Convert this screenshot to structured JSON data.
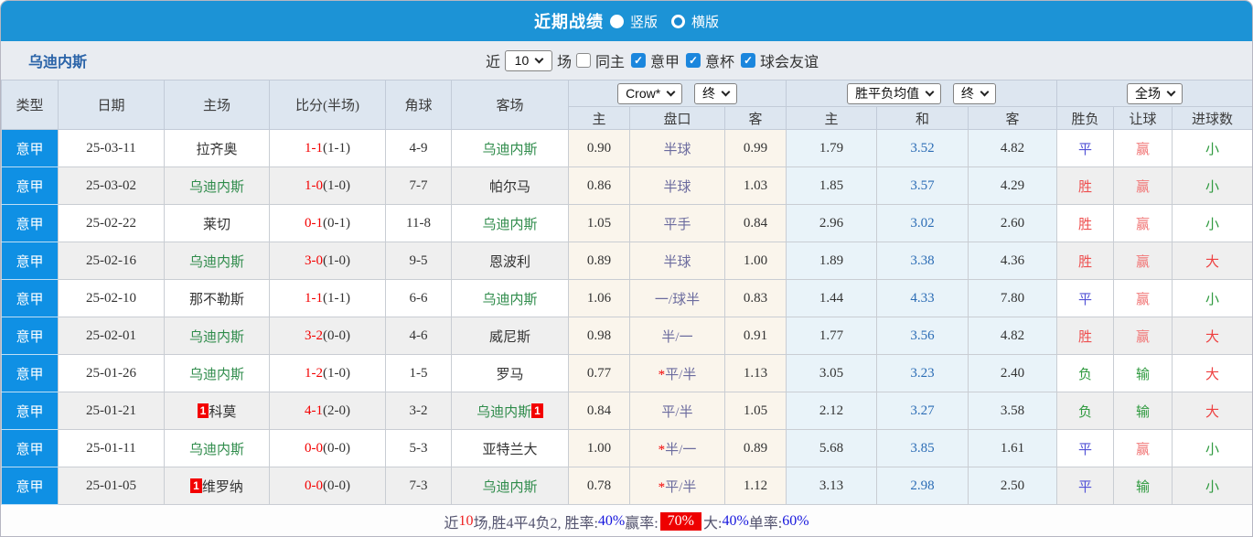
{
  "titlebar": {
    "title": "近期战绩",
    "radios": [
      {
        "label": "竖版",
        "checked": false
      },
      {
        "label": "横版",
        "checked": true
      }
    ]
  },
  "filterbar": {
    "team": "乌迪内斯",
    "recent_label": "近",
    "recent_value": "10",
    "matches_label": "场",
    "checkboxes": [
      {
        "label": "同主",
        "checked": false
      },
      {
        "label": "意甲",
        "checked": true
      },
      {
        "label": "意杯",
        "checked": true
      },
      {
        "label": "球会友谊",
        "checked": true
      }
    ]
  },
  "table": {
    "controls": {
      "bookmaker": "Crow*",
      "handicap_time": "终",
      "odds_source": "胜平负均值",
      "odds_time": "终",
      "scope": "全场"
    },
    "headers": {
      "type": "类型",
      "date": "日期",
      "home": "主场",
      "score": "比分(半场)",
      "corner": "角球",
      "away": "客场",
      "ah_home": "主",
      "ah_line": "盘口",
      "ah_away": "客",
      "eu_home": "主",
      "eu_draw": "和",
      "eu_away": "客",
      "result": "胜负",
      "handicap_result": "让球",
      "goals": "进球数"
    },
    "red_card_badge": "1",
    "rows": [
      {
        "league": "意甲",
        "date": "25-03-11",
        "home": "拉齐奥",
        "home_red": false,
        "score": "1-1",
        "half": "(1-1)",
        "corner": "4-9",
        "away": "乌迪内斯",
        "away_red": false,
        "ah_home": "0.90",
        "ah_star": false,
        "ah_line": "半球",
        "ah_away": "0.99",
        "eu_home": "1.79",
        "eu_draw": "3.52",
        "eu_away": "4.82",
        "result": "平",
        "handicap": "赢",
        "goals": "小"
      },
      {
        "league": "意甲",
        "date": "25-03-02",
        "home": "乌迪内斯",
        "home_red": false,
        "score": "1-0",
        "half": "(1-0)",
        "corner": "7-7",
        "away": "帕尔马",
        "away_red": false,
        "ah_home": "0.86",
        "ah_star": false,
        "ah_line": "半球",
        "ah_away": "1.03",
        "eu_home": "1.85",
        "eu_draw": "3.57",
        "eu_away": "4.29",
        "result": "胜",
        "handicap": "赢",
        "goals": "小"
      },
      {
        "league": "意甲",
        "date": "25-02-22",
        "home": "莱切",
        "home_red": false,
        "score": "0-1",
        "half": "(0-1)",
        "corner": "11-8",
        "away": "乌迪内斯",
        "away_red": false,
        "ah_home": "1.05",
        "ah_star": false,
        "ah_line": "平手",
        "ah_away": "0.84",
        "eu_home": "2.96",
        "eu_draw": "3.02",
        "eu_away": "2.60",
        "result": "胜",
        "handicap": "赢",
        "goals": "小"
      },
      {
        "league": "意甲",
        "date": "25-02-16",
        "home": "乌迪内斯",
        "home_red": false,
        "score": "3-0",
        "half": "(1-0)",
        "corner": "9-5",
        "away": "恩波利",
        "away_red": false,
        "ah_home": "0.89",
        "ah_star": false,
        "ah_line": "半球",
        "ah_away": "1.00",
        "eu_home": "1.89",
        "eu_draw": "3.38",
        "eu_away": "4.36",
        "result": "胜",
        "handicap": "赢",
        "goals": "大"
      },
      {
        "league": "意甲",
        "date": "25-02-10",
        "home": "那不勒斯",
        "home_red": false,
        "score": "1-1",
        "half": "(1-1)",
        "corner": "6-6",
        "away": "乌迪内斯",
        "away_red": false,
        "ah_home": "1.06",
        "ah_star": false,
        "ah_line": "一/球半",
        "ah_away": "0.83",
        "eu_home": "1.44",
        "eu_draw": "4.33",
        "eu_away": "7.80",
        "result": "平",
        "handicap": "赢",
        "goals": "小"
      },
      {
        "league": "意甲",
        "date": "25-02-01",
        "home": "乌迪内斯",
        "home_red": false,
        "score": "3-2",
        "half": "(0-0)",
        "corner": "4-6",
        "away": "威尼斯",
        "away_red": false,
        "ah_home": "0.98",
        "ah_star": false,
        "ah_line": "半/一",
        "ah_away": "0.91",
        "eu_home": "1.77",
        "eu_draw": "3.56",
        "eu_away": "4.82",
        "result": "胜",
        "handicap": "赢",
        "goals": "大"
      },
      {
        "league": "意甲",
        "date": "25-01-26",
        "home": "乌迪内斯",
        "home_red": false,
        "score": "1-2",
        "half": "(1-0)",
        "corner": "1-5",
        "away": "罗马",
        "away_red": false,
        "ah_home": "0.77",
        "ah_star": true,
        "ah_line": "平/半",
        "ah_away": "1.13",
        "eu_home": "3.05",
        "eu_draw": "3.23",
        "eu_away": "2.40",
        "result": "负",
        "handicap": "输",
        "goals": "大"
      },
      {
        "league": "意甲",
        "date": "25-01-21",
        "home": "科莫",
        "home_red": true,
        "score": "4-1",
        "half": "(2-0)",
        "corner": "3-2",
        "away": "乌迪内斯",
        "away_red": true,
        "ah_home": "0.84",
        "ah_star": false,
        "ah_line": "平/半",
        "ah_away": "1.05",
        "eu_home": "2.12",
        "eu_draw": "3.27",
        "eu_away": "3.58",
        "result": "负",
        "handicap": "输",
        "goals": "大"
      },
      {
        "league": "意甲",
        "date": "25-01-11",
        "home": "乌迪内斯",
        "home_red": false,
        "score": "0-0",
        "half": "(0-0)",
        "corner": "5-3",
        "away": "亚特兰大",
        "away_red": false,
        "ah_home": "1.00",
        "ah_star": true,
        "ah_line": "半/一",
        "ah_away": "0.89",
        "eu_home": "5.68",
        "eu_draw": "3.85",
        "eu_away": "1.61",
        "result": "平",
        "handicap": "赢",
        "goals": "小"
      },
      {
        "league": "意甲",
        "date": "25-01-05",
        "home": "维罗纳",
        "home_red": true,
        "score": "0-0",
        "half": "(0-0)",
        "corner": "7-3",
        "away": "乌迪内斯",
        "away_red": false,
        "ah_home": "0.78",
        "ah_star": true,
        "ah_line": "平/半",
        "ah_away": "1.12",
        "eu_home": "3.13",
        "eu_draw": "2.98",
        "eu_away": "2.50",
        "result": "平",
        "handicap": "输",
        "goals": "小"
      }
    ]
  },
  "summary": {
    "segments": [
      {
        "text": "近",
        "style": "label"
      },
      {
        "text": "10",
        "style": "red"
      },
      {
        "text": "场,胜4平4负2, 胜率:",
        "style": "label"
      },
      {
        "text": "40%",
        "style": "blue"
      },
      {
        "text": " 赢率:",
        "style": "label"
      },
      {
        "text": "70%",
        "style": "badge"
      },
      {
        "text": " 大:",
        "style": "label"
      },
      {
        "text": "40%",
        "style": "blue"
      },
      {
        "text": " 单率:",
        "style": "label"
      },
      {
        "text": "60%",
        "style": "blue"
      }
    ]
  }
}
